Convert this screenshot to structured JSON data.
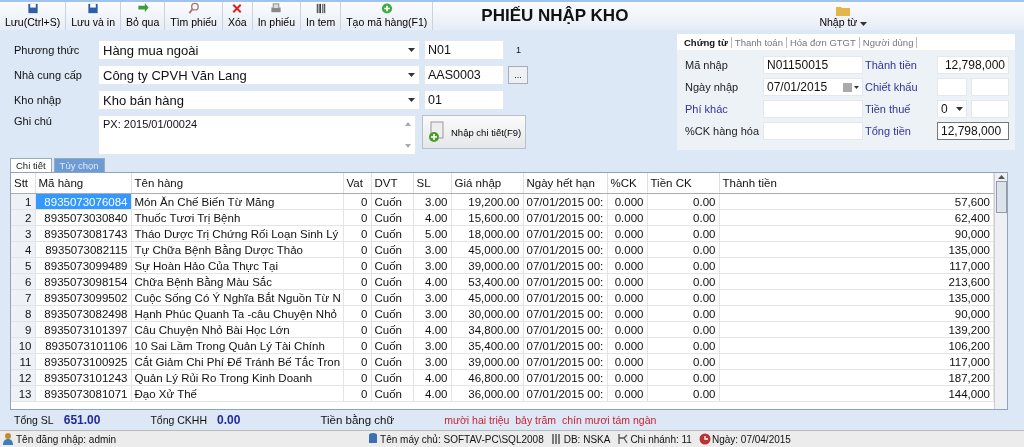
{
  "toolbar": {
    "buttons": [
      {
        "label": "Lưu(Ctrl+S)"
      },
      {
        "label": "Lưu và in"
      },
      {
        "label": "Bỏ qua"
      },
      {
        "label": "Tìm phiếu"
      },
      {
        "label": "Xóa"
      },
      {
        "label": "In phiếu"
      },
      {
        "label": "In tem"
      },
      {
        "label": "Tạo mã hàng(F1)"
      }
    ],
    "title": "PHIẾU NHẬP KHO",
    "import_menu": {
      "label": "Nhập từ"
    }
  },
  "form": {
    "fields": [
      {
        "label": "Phương thức",
        "value": "Hàng mua ngoài",
        "code": "N01",
        "note": "1"
      },
      {
        "label": "Nhà cung cấp",
        "value": "Công ty CPVH Văn Lang",
        "code": "AAS0003",
        "browse": "..."
      },
      {
        "label": "Kho nhập",
        "value": "Kho bán hàng",
        "code": "01"
      }
    ],
    "note": {
      "label": "Ghi chú",
      "value": "PX: 2015/01/00024"
    },
    "detail_button": "Nhập chi tiết(F9)"
  },
  "voucher": {
    "tabs": [
      {
        "label": "Chứng từ",
        "selected": true
      },
      {
        "label": "Thanh toán",
        "selected": false
      },
      {
        "label": "Hóa đơn GTGT",
        "selected": false
      },
      {
        "label": "Người dùng",
        "selected": false
      }
    ],
    "fields": [
      {
        "label": "Mã nhập",
        "kind": "text",
        "link": false,
        "value": "N01150015"
      },
      {
        "label": "Thành tiền",
        "kind": "number",
        "link": true,
        "value": "12,798,000"
      },
      {
        "label": "Ngày nhập",
        "kind": "date",
        "link": false,
        "value": "07/01/2015"
      },
      {
        "label": "Chiết khấu",
        "kind": "pair",
        "link": true
      },
      {
        "label": "Phí khác",
        "kind": "text",
        "link": true
      },
      {
        "label": "Tiền thuế",
        "kind": "select",
        "link": true,
        "value": "0"
      },
      {
        "label": "%CK hàng hóa",
        "kind": "text",
        "link": false
      },
      {
        "label": "Tổng tiền",
        "kind": "total",
        "link": true,
        "value": "12,798,000"
      }
    ]
  },
  "grid_tabs": [
    {
      "label": "Chi tiết",
      "selected": true
    },
    {
      "label": "Tùy chọn",
      "selected": false
    }
  ],
  "table": {
    "columns": [
      "Stt",
      "Mã hàng",
      "Tên hàng",
      "Vat",
      "DVT",
      "SL",
      "Giá nhập",
      "Ngày hết hạn",
      "%CK",
      "Tiền CK",
      "Thành tiền"
    ],
    "rows": [
      {
        "selected": true,
        "cells": [
          "1",
          "8935073076084",
          "Món Ăn Chế Biến Từ Măng",
          "0",
          "Cuốn",
          "3.00",
          "19,200.00",
          "07/01/2015 00:",
          "0.000",
          "0.00",
          "57,600"
        ]
      },
      {
        "selected": false,
        "cells": [
          "2",
          "8935073030840",
          "Thuốc Tươi Trị Bệnh",
          "0",
          "Cuốn",
          "4.00",
          "15,600.00",
          "07/01/2015 00:",
          "0.000",
          "0.00",
          "62,400"
        ]
      },
      {
        "selected": false,
        "cells": [
          "3",
          "8935073081743",
          "Tháo Dược Trị Chứng Rối Loạn Sinh Lý",
          "0",
          "Cuốn",
          "5.00",
          "18,000.00",
          "07/01/2015 00:",
          "0.000",
          "0.00",
          "90,000"
        ]
      },
      {
        "selected": false,
        "cells": [
          "4",
          "8935073082115",
          "Tự Chữa Bệnh Bằng Dược Thảo",
          "0",
          "Cuốn",
          "3.00",
          "45,000.00",
          "07/01/2015 00:",
          "0.000",
          "0.00",
          "135,000"
        ]
      },
      {
        "selected": false,
        "cells": [
          "5",
          "8935073099489",
          "Sự Hoàn Hảo Của Thực Tại",
          "0",
          "Cuốn",
          "3.00",
          "39,000.00",
          "07/01/2015 00:",
          "0.000",
          "0.00",
          "117,000"
        ]
      },
      {
        "selected": false,
        "cells": [
          "6",
          "8935073098154",
          "Chữa Bệnh Bằng Màu Sắc",
          "0",
          "Cuốn",
          "4.00",
          "53,400.00",
          "07/01/2015 00:",
          "0.000",
          "0.00",
          "213,600"
        ]
      },
      {
        "selected": false,
        "cells": [
          "7",
          "8935073099502",
          "Cuộc Sống Có Ý Nghĩa Bắt Nguồn Từ N",
          "0",
          "Cuốn",
          "3.00",
          "45,000.00",
          "07/01/2015 00:",
          "0.000",
          "0.00",
          "135,000"
        ]
      },
      {
        "selected": false,
        "cells": [
          "8",
          "8935073082498",
          "Hạnh Phúc Quanh Ta -câu Chuyện Nhỏ",
          "0",
          "Cuốn",
          "3.00",
          "30,000.00",
          "07/01/2015 00:",
          "0.000",
          "0.00",
          "90,000"
        ]
      },
      {
        "selected": false,
        "cells": [
          "9",
          "8935073101397",
          "Câu Chuyện Nhỏ Bài Học Lớn",
          "0",
          "Cuốn",
          "4.00",
          "34,800.00",
          "07/01/2015 00:",
          "0.000",
          "0.00",
          "139,200"
        ]
      },
      {
        "selected": false,
        "cells": [
          "10",
          "8935073101106",
          "10 Sai Lầm Trong Quản Lý Tài Chính",
          "0",
          "Cuốn",
          "3.00",
          "35,400.00",
          "07/01/2015 00:",
          "0.000",
          "0.00",
          "106,200"
        ]
      },
      {
        "selected": false,
        "cells": [
          "11",
          "8935073100925",
          "Cắt Giảm Chi Phí Để Tránh Bế Tắc Tron",
          "0",
          "Cuốn",
          "3.00",
          "39,000.00",
          "07/01/2015 00:",
          "0.000",
          "0.00",
          "117,000"
        ]
      },
      {
        "selected": false,
        "cells": [
          "12",
          "8935073101243",
          "Quản Lý Rủi Ro Trong Kinh Doanh",
          "0",
          "Cuốn",
          "4.00",
          "46,800.00",
          "07/01/2015 00:",
          "0.000",
          "0.00",
          "187,200"
        ]
      },
      {
        "selected": false,
        "cells": [
          "13",
          "8935073081071",
          "Đạo Xử Thế",
          "0",
          "Cuốn",
          "4.00",
          "36,000.00",
          "07/01/2015 00:",
          "0.000",
          "0.00",
          "144,000"
        ]
      }
    ]
  },
  "totals": [
    {
      "label": "Tổng SL",
      "value": "651.00"
    },
    {
      "label": "Tổng CKHH",
      "value": "0.00"
    }
  ],
  "amount_in_words": {
    "label": "Tiền bằng chữ",
    "value": "mười hai triệu  bảy trăm  chín mươi tám ngàn"
  },
  "status_bar": [
    {
      "label": "Tên đăng nhập:",
      "value": "admin"
    },
    {
      "label": "Tên máy chủ:",
      "value": "SOFTAV-PC\\SQL2008"
    },
    {
      "label": "DB:",
      "value": "NSKA"
    },
    {
      "label": "Chi nhánh:",
      "value": "11"
    },
    {
      "label": "Ngày:",
      "value": "07/04/2015"
    }
  ]
}
